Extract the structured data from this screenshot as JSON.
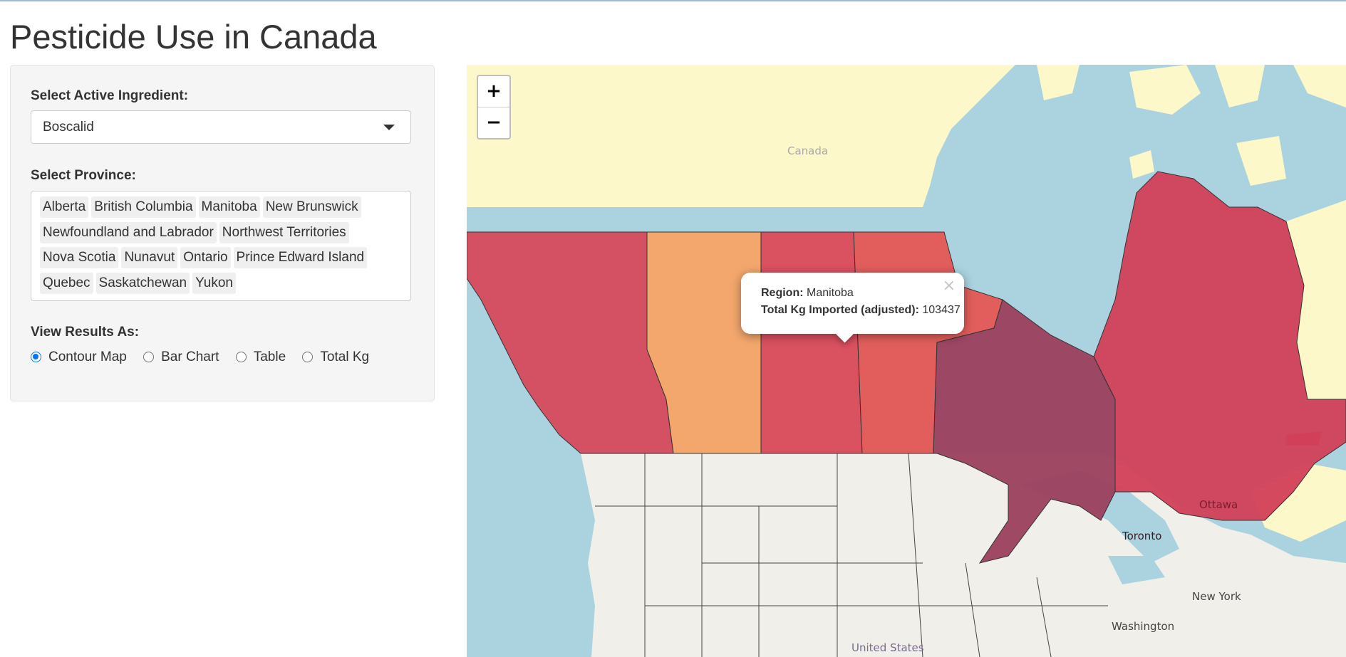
{
  "page": {
    "title": "Pesticide Use in Canada"
  },
  "sidebar": {
    "ingredient": {
      "label": "Select Active Ingredient:",
      "value": "Boscalid"
    },
    "province": {
      "label": "Select Province:",
      "selected": [
        "Alberta",
        "British Columbia",
        "Manitoba",
        "New Brunswick",
        "Newfoundland and Labrador",
        "Northwest Territories",
        "Nova Scotia",
        "Nunavut",
        "Ontario",
        "Prince Edward Island",
        "Quebec",
        "Saskatchewan",
        "Yukon"
      ]
    },
    "view": {
      "label": "View Results As:",
      "options": [
        "Contour Map",
        "Bar Chart",
        "Table",
        "Total Kg"
      ],
      "selected": "Contour Map"
    }
  },
  "map": {
    "zoom_in": "+",
    "zoom_out": "−",
    "labels": {
      "canada": "Canada",
      "ottawa": "Ottawa",
      "toronto": "Toronto",
      "new_york": "New York",
      "washington": "Washington",
      "united_states": "United States"
    },
    "colors": {
      "water": "#aad3df",
      "canada_base": "#fcf8c9",
      "us_land": "#f1efe9",
      "british_columbia": "#d64a5c",
      "alberta": "#f7a465",
      "saskatchewan": "#dc4a58",
      "manitoba": "#e55754",
      "ontario": "#9b3f5d",
      "quebec": "#d23f58"
    },
    "popup": {
      "region_label": "Region:",
      "region_value": "Manitoba",
      "kg_label": "Total Kg Imported (adjusted):",
      "kg_value": "103437",
      "close": "×"
    }
  }
}
